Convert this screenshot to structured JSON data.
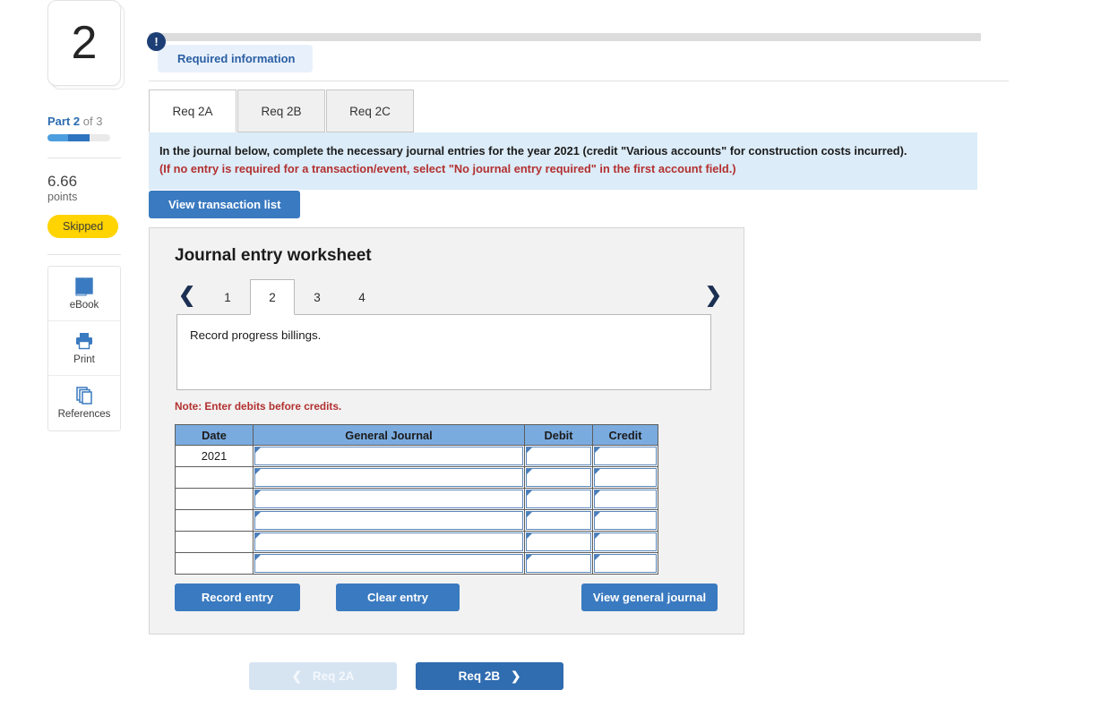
{
  "sidebar": {
    "question_number": "2",
    "part_prefix": "Part 2",
    "part_suffix": " of 3",
    "points_value": "6.66",
    "points_label": "points",
    "status_badge": "Skipped",
    "tools": [
      {
        "label": "eBook",
        "icon": "ebook-icon"
      },
      {
        "label": "Print",
        "icon": "printer-icon"
      },
      {
        "label": "References",
        "icon": "references-icon"
      }
    ]
  },
  "alert": {
    "icon": "exclamation-icon",
    "text": "Required information"
  },
  "tabs": [
    {
      "label": "Req 2A",
      "active": true
    },
    {
      "label": "Req 2B",
      "active": false
    },
    {
      "label": "Req 2C",
      "active": false
    }
  ],
  "instructions": {
    "line1": "In the journal below, complete the necessary journal entries for the year 2021 (credit \"Various accounts\" for construction costs incurred).",
    "line2": "(If no entry is required for a transaction/event, select \"No journal entry required\" in the first account field.)"
  },
  "toolbar": {
    "view_transaction_list": "View transaction list"
  },
  "worksheet": {
    "title": "Journal entry worksheet",
    "pager": {
      "prev_icon": "chevron-left-icon",
      "next_icon": "chevron-right-icon",
      "pages": [
        "1",
        "2",
        "3",
        "4"
      ],
      "active_page": "2"
    },
    "description": "Record progress billings.",
    "note": "Note: Enter debits before credits.",
    "table": {
      "headers": [
        "Date",
        "General Journal",
        "Debit",
        "Credit"
      ],
      "rows": [
        {
          "date": "2021",
          "general_journal": "",
          "debit": "",
          "credit": ""
        },
        {
          "date": "",
          "general_journal": "",
          "debit": "",
          "credit": ""
        },
        {
          "date": "",
          "general_journal": "",
          "debit": "",
          "credit": ""
        },
        {
          "date": "",
          "general_journal": "",
          "debit": "",
          "credit": ""
        },
        {
          "date": "",
          "general_journal": "",
          "debit": "",
          "credit": ""
        },
        {
          "date": "",
          "general_journal": "",
          "debit": "",
          "credit": ""
        }
      ]
    },
    "actions": {
      "record_entry": "Record entry",
      "clear_entry": "Clear entry",
      "view_general_journal": "View general journal"
    }
  },
  "footer_nav": {
    "prev_label": "Req 2A",
    "prev_icon": "chevron-left-icon",
    "next_label": "Req 2B",
    "next_icon": "chevron-right-icon"
  },
  "colors": {
    "primary_blue": "#3a7ac0",
    "dark_navy": "#1d3f76",
    "table_header_blue": "#7aabdf",
    "instruction_bg": "#dcecf8",
    "alert_bg": "#e8f1fb",
    "badge_yellow": "#FFD400",
    "note_red": "#b33030"
  }
}
